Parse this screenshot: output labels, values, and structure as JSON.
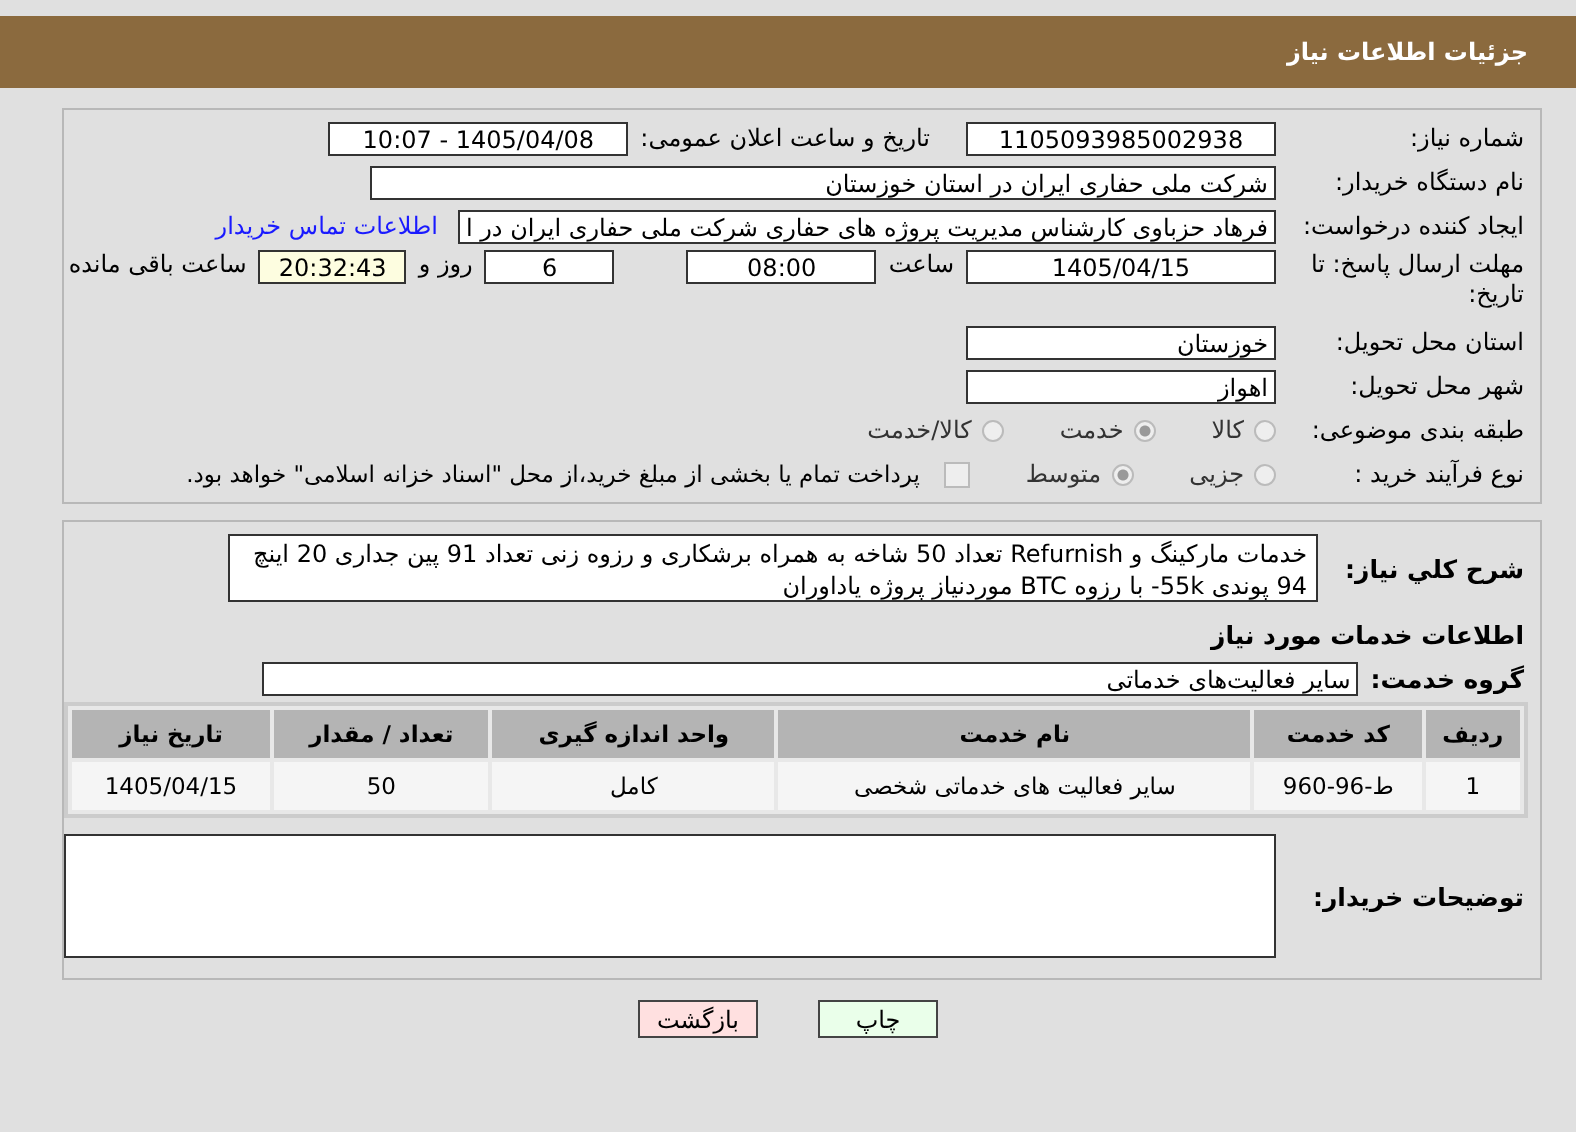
{
  "header": {
    "title": "جزئیات اطلاعات نیاز"
  },
  "details": {
    "need_number": {
      "label": "شماره نیاز:",
      "value": "1105093985002938"
    },
    "announce": {
      "label": "تاریخ و ساعت اعلان عمومی:",
      "value": "1405/04/08 - 10:07"
    },
    "buyer": {
      "label": "نام دستگاه خریدار:",
      "value": "شرکت ملی حفاری ایران در استان خوزستان"
    },
    "creator": {
      "label": "ایجاد کننده درخواست:",
      "value": "فرهاد حزباوی کارشناس مدیریت پروژه های حفاری شرکت ملی حفاری ایران در ا",
      "link": "اطلاعات تماس خریدار"
    },
    "deadline": {
      "label": "مهلت ارسال پاسخ: تا تاریخ:",
      "date": "1405/04/15",
      "time_label": "ساعت",
      "time": "08:00",
      "days": "6",
      "days_label": "روز و",
      "remaining": "20:32:43",
      "remaining_label": "ساعت باقی مانده"
    },
    "province": {
      "label": "استان محل تحویل:",
      "value": "خوزستان"
    },
    "city": {
      "label": "شهر محل تحویل:",
      "value": "اهواز"
    },
    "category": {
      "label": "طبقه بندی موضوعی:",
      "options": [
        {
          "label": "کالا",
          "selected": false
        },
        {
          "label": "خدمت",
          "selected": true
        },
        {
          "label": "کالا/خدمت",
          "selected": false
        }
      ]
    },
    "process": {
      "label": "نوع فرآیند خرید :",
      "options": [
        {
          "label": "جزیی",
          "selected": false
        },
        {
          "label": "متوسط",
          "selected": true
        }
      ],
      "payment": {
        "checked": false,
        "text": "پرداخت تمام یا بخشی از مبلغ خرید،از محل \"اسناد خزانه اسلامی\" خواهد بود."
      }
    }
  },
  "summary": {
    "label": "شرح کلي نياز:",
    "value": "خدمات مارکینگ و Refurnish  تعداد 50 شاخه به همراه برشکاری و رزوه زنی تعداد 91 پین جداری 20 اینچ 94 پوندی 55k- با رزوه BTC  موردنیاز پروژه یاداوران"
  },
  "services_heading": "اطلاعات خدمات مورد نیاز",
  "service_group": {
    "label": "گروه خدمت:",
    "value": "سایر فعالیت‌های خدماتی"
  },
  "table": {
    "columns": [
      "ردیف",
      "کد خدمت",
      "نام خدمت",
      "واحد اندازه گیری",
      "تعداد / مقدار",
      "تاریخ نیاز"
    ],
    "rows": [
      [
        "1",
        "ط-96-960",
        "سایر فعالیت های خدماتی شخصی",
        "کامل",
        "50",
        "1405/04/15"
      ]
    ]
  },
  "buyer_notes": {
    "label": "توضیحات خریدار:"
  },
  "buttons": [
    {
      "label": "چاپ",
      "kind": "print"
    },
    {
      "label": "بازگشت",
      "kind": "back"
    }
  ]
}
